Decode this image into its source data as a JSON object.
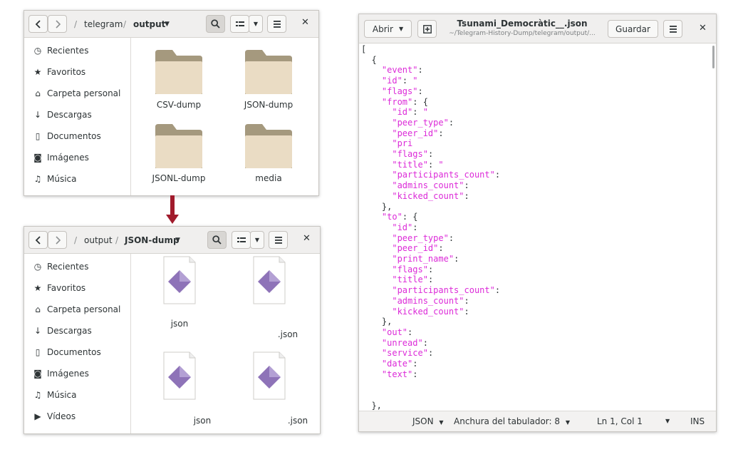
{
  "files_top": {
    "breadcrumb": [
      "telegram",
      "output"
    ],
    "sidebar": [
      "Recientes",
      "Favoritos",
      "Carpeta personal",
      "Descargas",
      "Documentos",
      "Imágenes",
      "Música"
    ],
    "items": [
      "CSV-dump",
      "JSON-dump",
      "JSONL-dump",
      "media"
    ]
  },
  "files_bottom": {
    "breadcrumb": [
      "output",
      "JSON-dump"
    ],
    "sidebar": [
      "Recientes",
      "Favoritos",
      "Carpeta personal",
      "Descargas",
      "Documentos",
      "Imágenes",
      "Música",
      "Vídeos"
    ],
    "items": [
      "json",
      ".json",
      "json",
      ".json"
    ]
  },
  "editor": {
    "open_label": "Abrir",
    "title": "Tsunami_Democràtic__.json",
    "subtitle": "~/Telegram-History-Dump/telegram/output/...",
    "save_label": "Guardar",
    "lines": [
      "[",
      "  {",
      "    \"event\":",
      "    \"id\": \"",
      "    \"flags\":",
      "    \"from\": {",
      "      \"id\": \"",
      "      \"peer_type\":",
      "      \"peer_id\":",
      "      \"pri",
      "      \"flags\":",
      "      \"title\": \"",
      "      \"participants_count\":",
      "      \"admins_count\":",
      "      \"kicked_count\":",
      "    },",
      "    \"to\": {",
      "      \"id\":",
      "      \"peer_type\":",
      "      \"peer_id\":",
      "      \"print_name\":",
      "      \"flags\":",
      "      \"title\":",
      "      \"participants_count\":",
      "      \"admins_count\":",
      "      \"kicked_count\":",
      "    },",
      "    \"out\":",
      "    \"unread\":",
      "    \"service\":",
      "    \"date\":",
      "    \"text\":",
      "",
      "",
      "  },"
    ],
    "status": {
      "language": "JSON",
      "tab_width": "Anchura del tabulador: 8",
      "position": "Ln 1, Col 1",
      "mode": "INS"
    }
  },
  "colors": {
    "accent": "#2a76c6",
    "json_key": "#dc2ad8",
    "arrow": "#a11b2c"
  }
}
